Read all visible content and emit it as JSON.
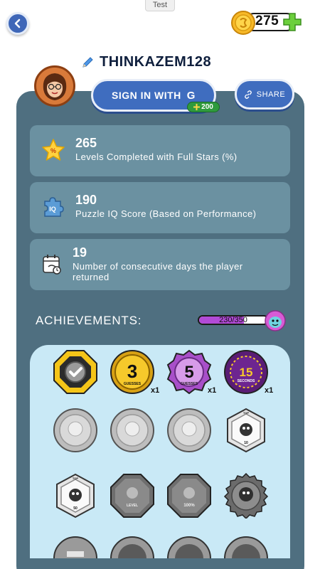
{
  "top_bar": {
    "test_label": "Test",
    "coin_count": "275"
  },
  "profile": {
    "username": "THINKAZEM128",
    "signin_label": "SIGN IN WITH",
    "signin_provider": "G",
    "signin_bonus": "200",
    "share_label": "SHARE"
  },
  "stats": [
    {
      "value": "265",
      "description": "Levels Completed with Full Stars (%)",
      "icon": "star-icon"
    },
    {
      "value": "190",
      "description": "Puzzle IQ Score (Based on Performance)",
      "icon": "puzzle-iq-icon"
    },
    {
      "value": "19",
      "description": "Number of consecutive days the player returned",
      "icon": "calendar-icon"
    }
  ],
  "achievements": {
    "title": "ACHIEVEMENTS:",
    "progress_text": "230/350",
    "progress_fraction": 0.657,
    "badges": [
      {
        "name": "check-badge",
        "label": "",
        "multiplier": ""
      },
      {
        "name": "three-guesses-badge",
        "label": "3",
        "sublabel": "GUESSES",
        "multiplier": "x1"
      },
      {
        "name": "five-guesses-badge",
        "label": "5",
        "sublabel": "GUESSES",
        "multiplier": "x1"
      },
      {
        "name": "fifteen-seconds-badge",
        "label": "15",
        "sublabel": "SECONDS",
        "multiplier": "x1"
      },
      {
        "name": "locked-badge-1",
        "label": "",
        "multiplier": ""
      },
      {
        "name": "locked-badge-2",
        "label": "",
        "multiplier": ""
      },
      {
        "name": "locked-badge-3",
        "label": "",
        "multiplier": ""
      },
      {
        "name": "top-10-badge",
        "label": "10",
        "toplabel": "TOP",
        "multiplier": ""
      },
      {
        "name": "top-50-badge",
        "label": "50",
        "toplabel": "TOP",
        "multiplier": ""
      },
      {
        "name": "level-badge",
        "label": "LEVEL",
        "multiplier": ""
      },
      {
        "name": "hundred-percent-badge",
        "label": "100%",
        "multiplier": ""
      },
      {
        "name": "locked-badge-4",
        "label": "",
        "multiplier": ""
      }
    ]
  },
  "colors": {
    "panel": "#4f6f80",
    "card": "#6b91a1",
    "button": "#3f6dbf",
    "grid_bg": "#c9e9f6",
    "progress_fill": "#b24ad6"
  }
}
